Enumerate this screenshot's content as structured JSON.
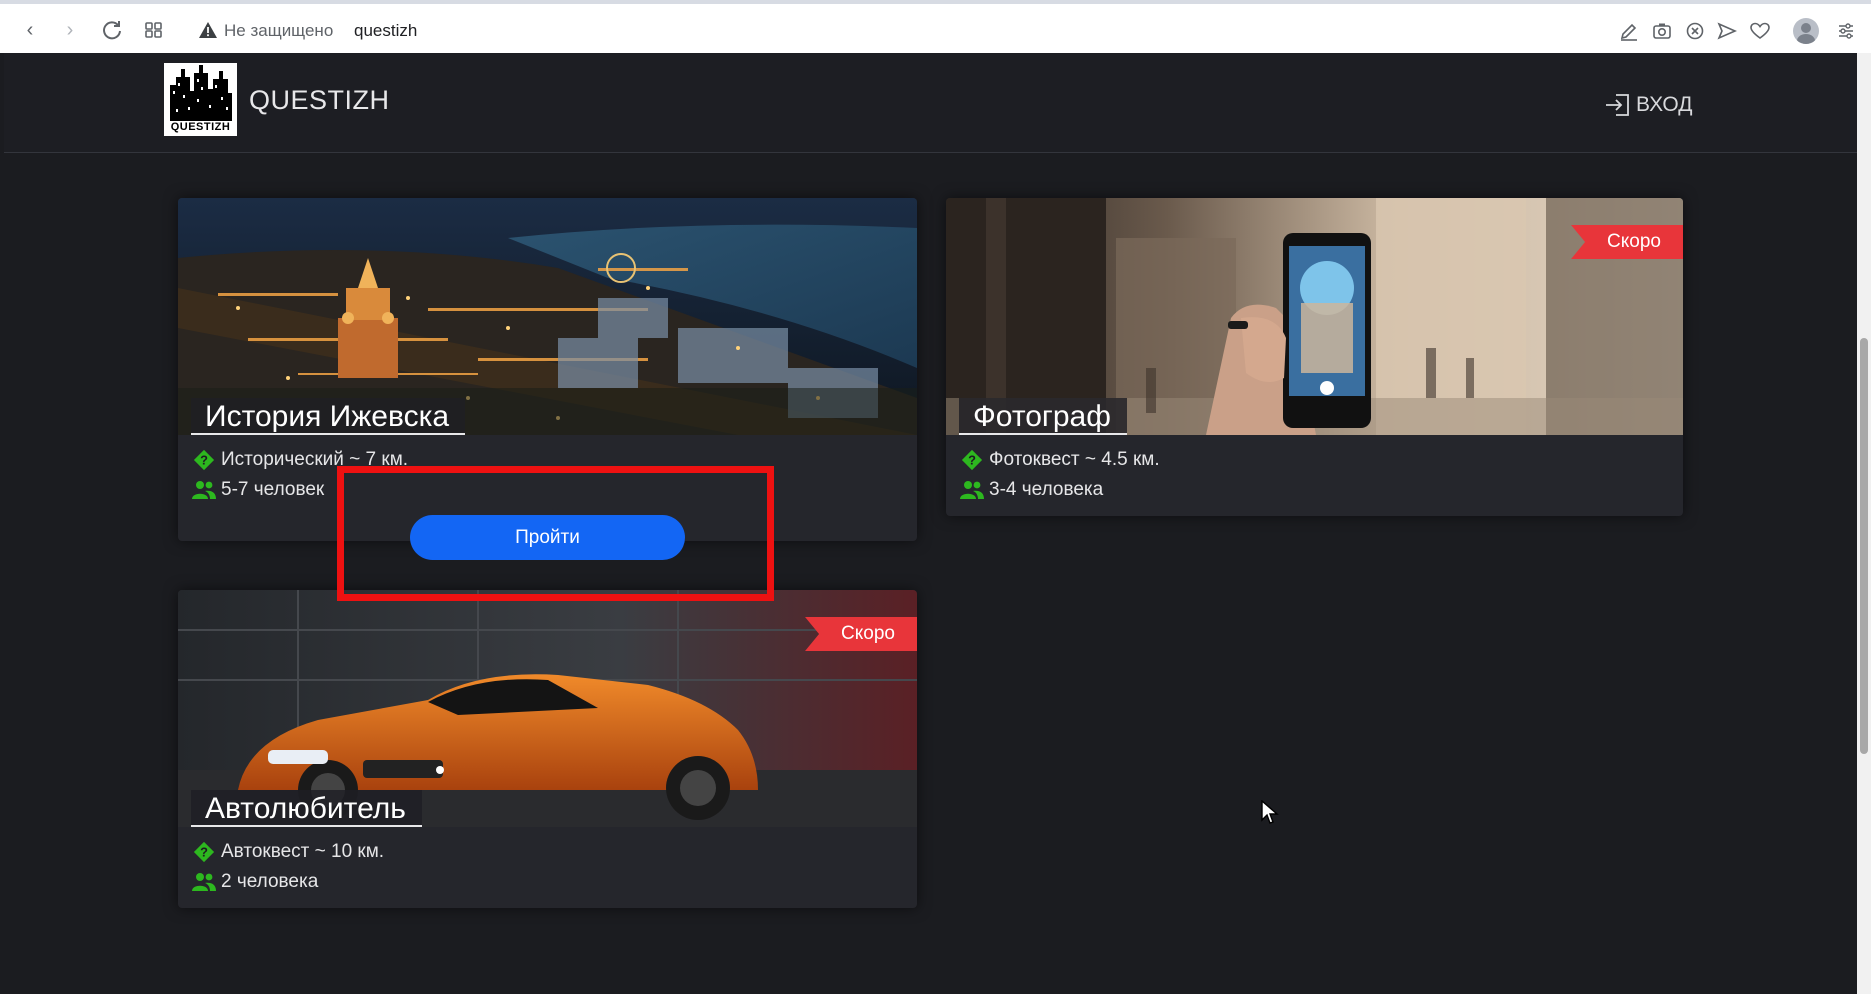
{
  "browser": {
    "security_label": "Не защищено",
    "url": "questizh"
  },
  "header": {
    "logo_text": "QUESTIZH",
    "site_title": "QUESTIZH",
    "login_label": "ВХОД"
  },
  "cards": [
    {
      "title": "История Ижевска",
      "type_text": "Исторический ~ 7 км.",
      "people_text": "5-7 человек",
      "badge": "",
      "image": "night-city-aerial"
    },
    {
      "title": "Фотограф",
      "type_text": "Фотоквест ~ 4.5 км.",
      "people_text": "3-4 человека",
      "badge": "Скоро",
      "image": "phone-photo-street"
    },
    {
      "title": "Автолюбитель",
      "type_text": "Автоквест ~ 10 км.",
      "people_text": "2 человека",
      "badge": "Скоро",
      "image": "orange-sports-car"
    }
  ],
  "go_button_label": "Пройти",
  "colors": {
    "page_bg": "#1b1c20",
    "card_bg": "#25262c",
    "accent_blue": "#1366f4",
    "badge_red": "#e8353a",
    "icon_green": "#2db81f",
    "highlight_red": "#ee1111"
  }
}
